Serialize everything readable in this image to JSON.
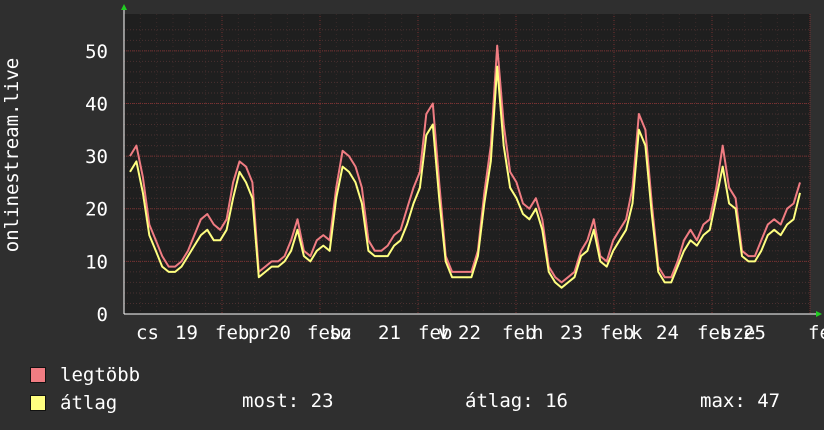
{
  "chart_data": {
    "type": "line",
    "ylabel": "onlinestream.live",
    "ylim": [
      0,
      57
    ],
    "y_ticks": [
      "0",
      "10",
      "20",
      "30",
      "40",
      "50"
    ],
    "x_tick_labels": [
      "cs",
      "19",
      "feb",
      "p",
      "r",
      "20",
      "feb",
      "sz",
      "o",
      "21",
      "feb",
      "v",
      "22",
      "feb",
      "h",
      "23",
      "feb",
      "k",
      "24",
      "feb",
      "sze",
      "25",
      "fe"
    ],
    "grid": true,
    "colors": {
      "max": "#f07c82",
      "avg": "#ffff80",
      "background": "#2f2f2f",
      "plot": "#1f1f1f",
      "grid": "#7a3030"
    },
    "series": [
      {
        "name": "legtöbb",
        "values": [
          30,
          32,
          26,
          17,
          14,
          11,
          9,
          9,
          10,
          12,
          15,
          18,
          19,
          17,
          16,
          18,
          25,
          29,
          28,
          25,
          8,
          9,
          10,
          10,
          11,
          14,
          18,
          12,
          11,
          14,
          15,
          14,
          24,
          31,
          30,
          28,
          24,
          14,
          12,
          12,
          13,
          15,
          16,
          20,
          24,
          27,
          38,
          40,
          25,
          11,
          8,
          8,
          8,
          8,
          12,
          23,
          32,
          51,
          36,
          27,
          25,
          21,
          20,
          22,
          18,
          9,
          7,
          6,
          7,
          8,
          12,
          14,
          18,
          11,
          10,
          14,
          16,
          18,
          24,
          38,
          35,
          21,
          9,
          7,
          7,
          10,
          14,
          16,
          14,
          17,
          18,
          24,
          32,
          24,
          22,
          12,
          11,
          11,
          14,
          17,
          18,
          17,
          20,
          21,
          25
        ]
      },
      {
        "name": "átlag",
        "values": [
          27,
          29,
          23,
          15,
          12,
          9,
          8,
          8,
          9,
          11,
          13,
          15,
          16,
          14,
          14,
          16,
          22,
          27,
          25,
          22,
          7,
          8,
          9,
          9,
          10,
          12,
          16,
          11,
          10,
          12,
          13,
          12,
          22,
          28,
          27,
          25,
          21,
          12,
          11,
          11,
          11,
          13,
          14,
          17,
          21,
          24,
          34,
          36,
          22,
          10,
          7,
          7,
          7,
          7,
          11,
          21,
          29,
          47,
          32,
          24,
          22,
          19,
          18,
          20,
          16,
          8,
          6,
          5,
          6,
          7,
          11,
          12,
          16,
          10,
          9,
          12,
          14,
          16,
          21,
          35,
          32,
          19,
          8,
          6,
          6,
          9,
          12,
          14,
          13,
          15,
          16,
          22,
          28,
          21,
          20,
          11,
          10,
          10,
          12,
          15,
          16,
          15,
          17,
          18,
          23
        ]
      }
    ]
  },
  "legend": {
    "max_label": "legtöbb",
    "avg_label": "átlag",
    "current": "most: 23",
    "average": "átlag: 16",
    "maximum": "max: 47"
  }
}
